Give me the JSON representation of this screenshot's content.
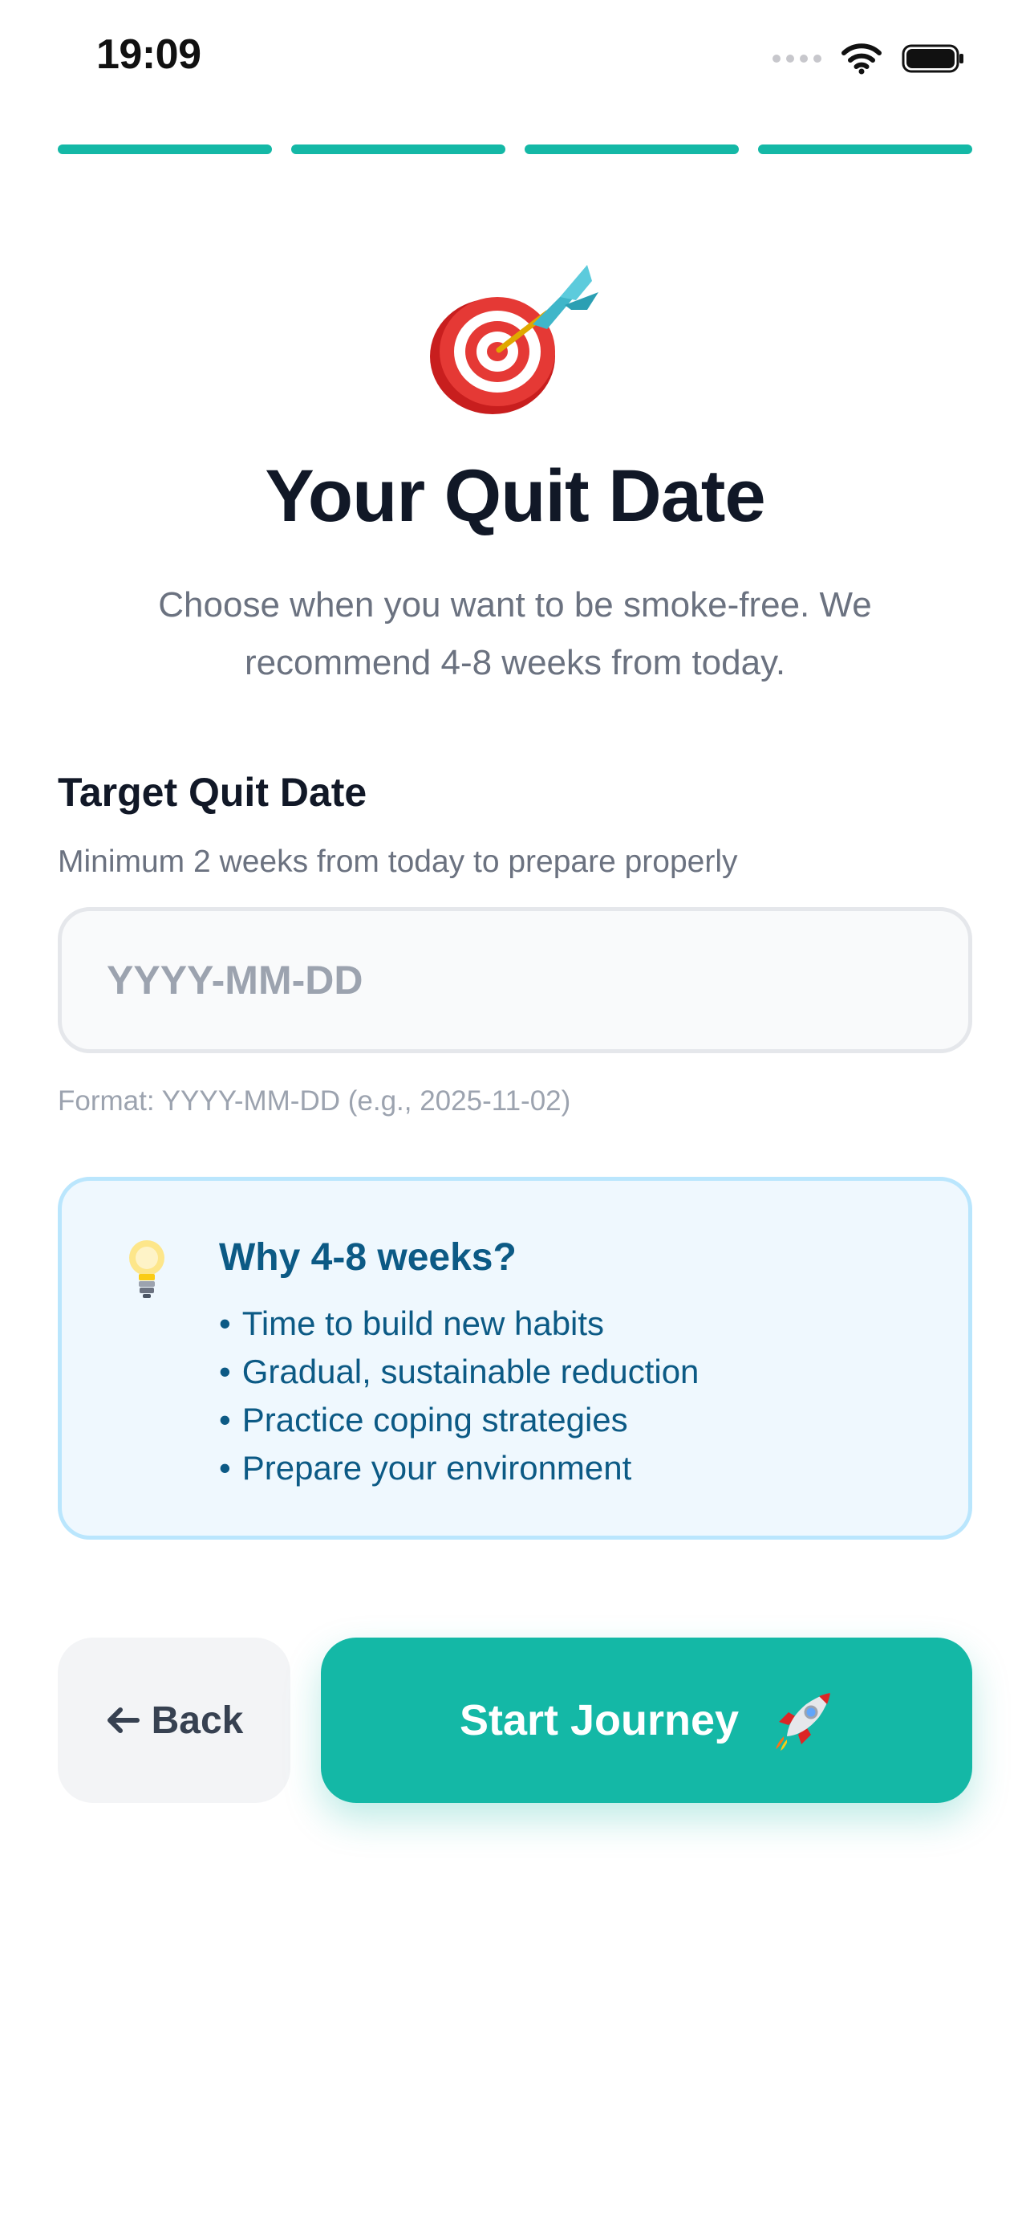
{
  "status_bar": {
    "time": "19:09",
    "icons": [
      "cellular-signal-icon",
      "wifi-icon",
      "battery-icon"
    ]
  },
  "progress": {
    "total_steps": 4,
    "completed_steps": 4,
    "color": "#14b8a6"
  },
  "hero": {
    "icon": "bullseye-dart-icon",
    "title": "Your Quit Date",
    "subtitle": "Choose when you want to be smoke-free. We recommend 4-8 weeks from today."
  },
  "form": {
    "label": "Target Quit Date",
    "hint": "Minimum 2 weeks from today to prepare properly",
    "input": {
      "value": "",
      "placeholder": "YYYY-MM-DD"
    },
    "format_hint": "Format: YYYY-MM-DD (e.g., 2025-11-02)"
  },
  "info_card": {
    "icon": "lightbulb-icon",
    "title": "Why 4-8 weeks?",
    "items": [
      "Time to build new habits",
      "Gradual, sustainable reduction",
      "Practice coping strategies",
      "Prepare your environment"
    ]
  },
  "actions": {
    "back": {
      "icon": "arrow-left-icon",
      "label": "Back"
    },
    "start": {
      "label": "Start Journey",
      "icon": "rocket-icon",
      "color": "#14b8a6"
    }
  },
  "colors": {
    "accent": "#14b8a6",
    "title": "#111827",
    "muted": "#6b7280",
    "info_text": "#0c5a85",
    "info_background": "#eff8fe",
    "info_border": "#bae6fd"
  }
}
